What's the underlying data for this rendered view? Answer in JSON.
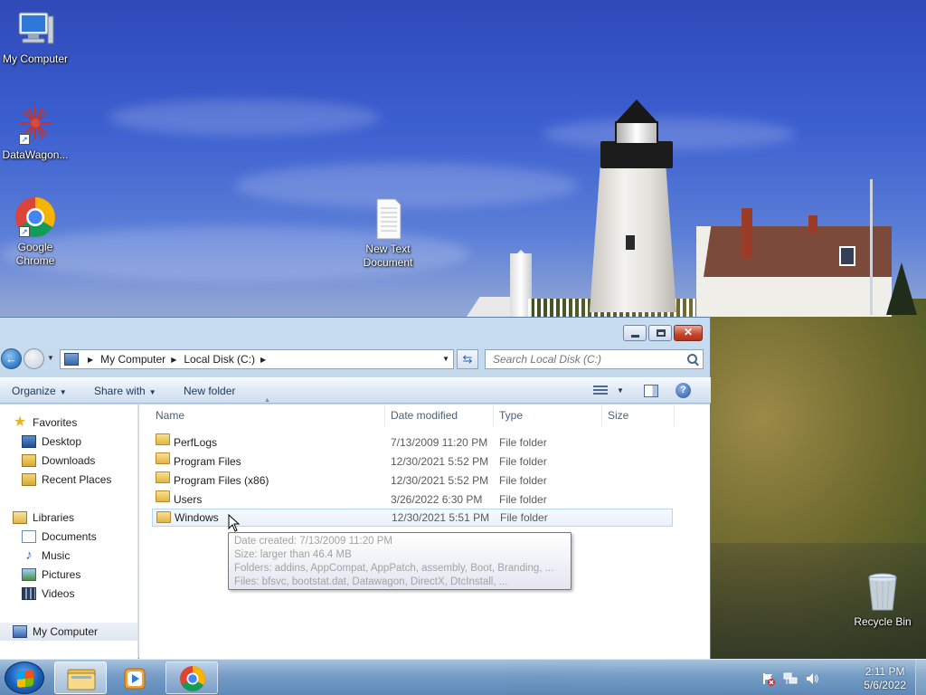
{
  "desktop": {
    "icons": [
      {
        "label": "My Computer",
        "icon": "computer-icon"
      },
      {
        "label": "DataWagon...",
        "icon": "datawagon-shortcut-icon"
      },
      {
        "label": "Google Chrome",
        "icon": "chrome-icon"
      },
      {
        "label": "New Text Document",
        "icon": "text-document-icon"
      },
      {
        "label": "Recycle Bin",
        "icon": "recycle-bin-icon"
      }
    ]
  },
  "explorer": {
    "breadcrumb": [
      "My Computer",
      "Local Disk (C:)"
    ],
    "search_placeholder": "Search Local Disk (C:)",
    "toolbar": {
      "organize": "Organize",
      "share_with": "Share with",
      "new_folder": "New folder"
    },
    "nav": {
      "favorites": "Favorites",
      "desktop": "Desktop",
      "downloads": "Downloads",
      "recent_places": "Recent Places",
      "libraries": "Libraries",
      "documents": "Documents",
      "music": "Music",
      "pictures": "Pictures",
      "videos": "Videos",
      "my_computer": "My Computer"
    },
    "columns": {
      "name": "Name",
      "date": "Date modified",
      "type": "Type",
      "size": "Size"
    },
    "rows": [
      {
        "name": "PerfLogs",
        "date": "7/13/2009 11:20 PM",
        "type": "File folder"
      },
      {
        "name": "Program Files",
        "date": "12/30/2021 5:52 PM",
        "type": "File folder"
      },
      {
        "name": "Program Files (x86)",
        "date": "12/30/2021 5:52 PM",
        "type": "File folder"
      },
      {
        "name": "Users",
        "date": "3/26/2022 6:30 PM",
        "type": "File folder"
      },
      {
        "name": "Windows",
        "date": "12/30/2021 5:51 PM",
        "type": "File folder"
      }
    ],
    "tooltip": {
      "created": "Date created: 7/13/2009 11:20 PM",
      "size": "Size: larger than 46.4 MB",
      "folders": "Folders: addins, AppCompat, AppPatch, assembly, Boot, Branding, ...",
      "files": "Files: bfsvc, bootstat.dat, Datawagon, DirectX, DtcInstall, ..."
    },
    "hovered_row": "Windows"
  },
  "taskbar": {
    "clock_time": "2:11 PM",
    "clock_date": "5/6/2022"
  },
  "colors": {
    "accent": "#2e7bc8",
    "close_button": "#c4432b",
    "selection_border": "#b8d6fb"
  }
}
